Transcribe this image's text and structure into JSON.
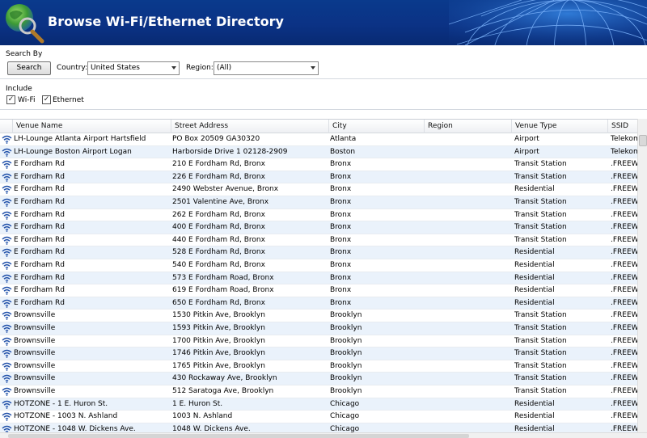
{
  "header": {
    "title": "Browse Wi-Fi/Ethernet Directory"
  },
  "search": {
    "group_label": "Search By",
    "search_button": "Search",
    "country_label": "Country:",
    "country_value": "United States",
    "region_label": "Region:",
    "region_value": "(All)"
  },
  "include": {
    "group_label": "Include",
    "wifi_label": "Wi-Fi",
    "wifi_checked": "✓",
    "ethernet_label": "Ethernet",
    "ethernet_checked": "✓"
  },
  "table": {
    "columns": [
      "Venue Name",
      "Street Address",
      "City",
      "Region",
      "Venue Type",
      "SSID"
    ],
    "rows": [
      [
        "LH-Lounge Atlanta Airport Hartsfield",
        "PO Box 20509  GA30320",
        "Atlanta",
        "",
        "Airport",
        "Telekom"
      ],
      [
        "LH-Lounge Boston Airport Logan",
        "Harborside Drive 1 02128-2909",
        "Boston",
        "",
        "Airport",
        "Telekom"
      ],
      [
        "E Fordham Rd",
        "210 E Fordham Rd, Bronx",
        "Bronx",
        "",
        "Transit Station",
        ".FREEWiFi"
      ],
      [
        "E Fordham Rd",
        "226 E Fordham Rd, Bronx",
        "Bronx",
        "",
        "Transit Station",
        ".FREEWiFi"
      ],
      [
        "E Fordham Rd",
        "2490 Webster Avenue, Bronx",
        "Bronx",
        "",
        "Residential",
        ".FREEWiFi"
      ],
      [
        "E Fordham Rd",
        "2501 Valentine Ave, Bronx",
        "Bronx",
        "",
        "Transit Station",
        ".FREEWiFi"
      ],
      [
        "E Fordham Rd",
        "262 E Fordham Rd, Bronx",
        "Bronx",
        "",
        "Transit Station",
        ".FREEWiFi"
      ],
      [
        "E Fordham Rd",
        "400 E Fordham Rd, Bronx",
        "Bronx",
        "",
        "Transit Station",
        ".FREEWiFi"
      ],
      [
        "E Fordham Rd",
        "440 E Fordham Rd, Bronx",
        "Bronx",
        "",
        "Transit Station",
        ".FREEWiFi"
      ],
      [
        "E Fordham Rd",
        "528 E Fordham Rd, Bronx",
        "Bronx",
        "",
        "Residential",
        ".FREEWiFi"
      ],
      [
        "E Fordham Rd",
        "540 E Fordham Rd, Bronx",
        "Bronx",
        "",
        "Residential",
        ".FREEWiFi"
      ],
      [
        "E Fordham Rd",
        "573 E Fordham Road, Bronx",
        "Bronx",
        "",
        "Residential",
        ".FREEWiFi"
      ],
      [
        "E Fordham Rd",
        "619 E Fordham Road, Bronx",
        "Bronx",
        "",
        "Residential",
        ".FREEWiFi"
      ],
      [
        "E Fordham Rd",
        "650 E Fordham Rd, Bronx",
        "Bronx",
        "",
        "Residential",
        ".FREEWiFi"
      ],
      [
        "Brownsville",
        "1530 Pitkin Ave, Brooklyn",
        "Brooklyn",
        "",
        "Transit Station",
        ".FREEWiFi"
      ],
      [
        "Brownsville",
        "1593 Pitkin Ave, Brooklyn",
        "Brooklyn",
        "",
        "Transit Station",
        ".FREEWiFi"
      ],
      [
        "Brownsville",
        "1700 Pitkin Ave, Brooklyn",
        "Brooklyn",
        "",
        "Transit Station",
        ".FREEWiFi"
      ],
      [
        "Brownsville",
        "1746 Pitkin Ave, Brooklyn",
        "Brooklyn",
        "",
        "Transit Station",
        ".FREEWiFi"
      ],
      [
        "Brownsville",
        "1765 Pitkin Ave, Brooklyn",
        "Brooklyn",
        "",
        "Transit Station",
        ".FREEWiFi"
      ],
      [
        "Brownsville",
        "430 Rockaway Ave, Brooklyn",
        "Brooklyn",
        "",
        "Transit Station",
        ".FREEWiFi"
      ],
      [
        "Brownsville",
        "512 Saratoga Ave, Brooklyn",
        "Brooklyn",
        "",
        "Transit Station",
        ".FREEWiFi"
      ],
      [
        "HOTZONE - 1 E. Huron St.",
        "1 E. Huron St.",
        "Chicago",
        "",
        "Residential",
        ".FREEWiFi"
      ],
      [
        "HOTZONE - 1003 N. Ashland",
        "1003 N. Ashland",
        "Chicago",
        "",
        "Residential",
        ".FREEWiFi"
      ],
      [
        "HOTZONE - 1048 W. Dickens Ave.",
        "1048 W. Dickens Ave.",
        "Chicago",
        "",
        "Residential",
        ".FREEWiFi"
      ]
    ]
  },
  "colors": {
    "banner": "#0b3285",
    "alt_row": "#eaf2fb",
    "wifi_icon": "#1f4fa8"
  }
}
